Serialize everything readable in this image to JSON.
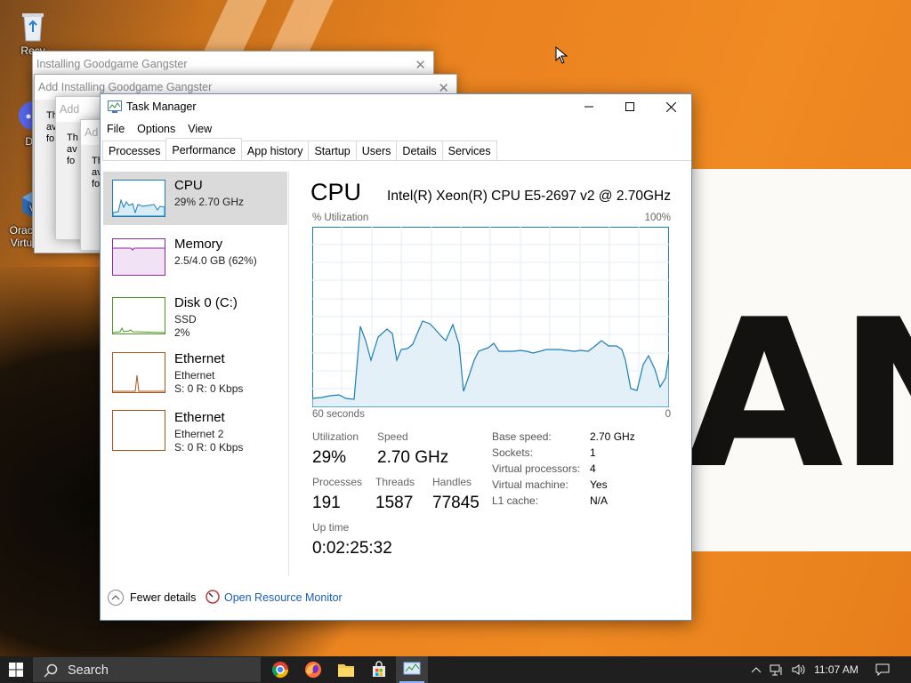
{
  "desktop": {
    "icons": [
      {
        "label": "Recy",
        "icon": "recycle-bin-icon"
      },
      {
        "label": "Dis",
        "icon": "discord-icon"
      },
      {
        "label": "Oracle VM VirtualBox",
        "icon": "virtualbox-icon"
      }
    ],
    "background_text": "ANT"
  },
  "installer_windows": [
    {
      "title": "Installing Goodgame Gangster",
      "body_fragment": [
        "Add",
        "Th",
        "av",
        "fo"
      ]
    },
    {
      "title": "Installing Goodgame Gangster",
      "body_fragment": [
        "Add",
        "Th",
        "av",
        "fo"
      ]
    },
    {
      "title": "Add",
      "body_fragment": [
        "Th",
        "av",
        "fo"
      ]
    },
    {
      "title": "Ad",
      "body_fragment": []
    }
  ],
  "task_manager": {
    "title": "Task Manager",
    "menu": [
      "File",
      "Options",
      "View"
    ],
    "tabs": [
      {
        "label": "Processes",
        "active": false
      },
      {
        "label": "Performance",
        "active": true
      },
      {
        "label": "App history",
        "active": false
      },
      {
        "label": "Startup",
        "active": false
      },
      {
        "label": "Users",
        "active": false
      },
      {
        "label": "Details",
        "active": false
      },
      {
        "label": "Services",
        "active": false
      }
    ],
    "sidebar": [
      {
        "name": "CPU",
        "line1": "29% 2.70 GHz",
        "line2": "",
        "color": "#1a7fb5",
        "selected": true
      },
      {
        "name": "Memory",
        "line1": "2.5/4.0 GB (62%)",
        "line2": "",
        "color": "#8b2aa3",
        "selected": false
      },
      {
        "name": "Disk 0 (C:)",
        "line1": "SSD",
        "line2": "2%",
        "color": "#4c9a24",
        "selected": false
      },
      {
        "name": "Ethernet",
        "line1": "Ethernet",
        "line2": "S: 0 R: 0 Kbps",
        "color": "#a7551a",
        "selected": false
      },
      {
        "name": "Ethernet",
        "line1": "Ethernet 2",
        "line2": "S: 0 R: 0 Kbps",
        "color": "#a7551a",
        "selected": false
      }
    ],
    "detail": {
      "title": "CPU",
      "model": "Intel(R) Xeon(R) CPU E5-2697 v2 @ 2.70GHz",
      "graph_label": "% Utilization",
      "graph_max": "100%",
      "graph_left": "60 seconds",
      "graph_right": "0",
      "stats": {
        "utilization_label": "Utilization",
        "utilization": "29%",
        "speed_label": "Speed",
        "speed": "2.70 GHz",
        "processes_label": "Processes",
        "processes": "191",
        "threads_label": "Threads",
        "threads": "1587",
        "handles_label": "Handles",
        "handles": "77845",
        "uptime_label": "Up time",
        "uptime": "0:02:25:32"
      },
      "specs": [
        {
          "key": "Base speed:",
          "value": "2.70 GHz"
        },
        {
          "key": "Sockets:",
          "value": "1"
        },
        {
          "key": "Virtual processors:",
          "value": "4"
        },
        {
          "key": "Virtual machine:",
          "value": "Yes"
        },
        {
          "key": "L1 cache:",
          "value": "N/A"
        }
      ]
    },
    "footer": {
      "fewer_details": "Fewer details",
      "open_resource_monitor": "Open Resource Monitor"
    }
  },
  "taskbar": {
    "search_placeholder": "Search",
    "apps": [
      "chrome-icon",
      "firefox-icon",
      "file-explorer-icon",
      "store-icon",
      "task-manager-icon"
    ],
    "clock": "11:07 AM"
  }
}
